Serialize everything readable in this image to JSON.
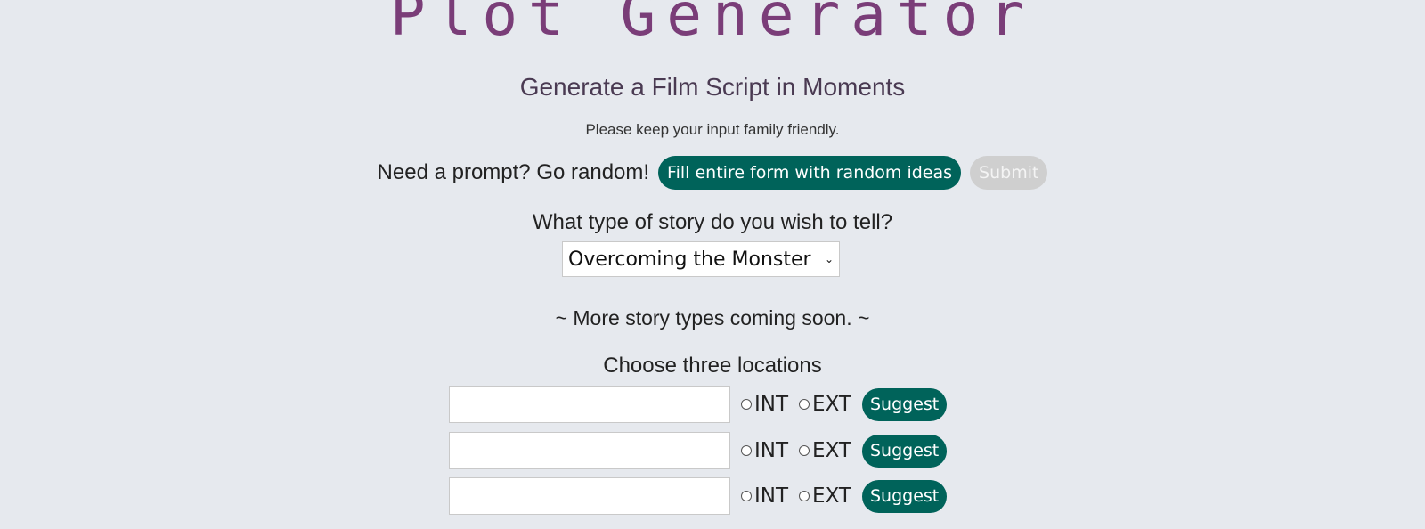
{
  "header": {
    "title": "Plot Generator",
    "subtitle": "Generate a Film Script in Moments",
    "note": "Please keep your input family friendly."
  },
  "random": {
    "prompt_text": "Need a prompt? Go random!",
    "fill_button": "Fill entire form with random ideas",
    "submit_button": "Submit"
  },
  "story_type": {
    "question": "What type of story do you wish to tell?",
    "selected": "Overcoming the Monster",
    "coming_soon": "~ More story types coming soon. ~"
  },
  "locations": {
    "heading": "Choose three locations",
    "rows": [
      {
        "value": "",
        "int_label": "INT",
        "ext_label": "EXT",
        "suggest_label": "Suggest"
      },
      {
        "value": "",
        "int_label": "INT",
        "ext_label": "EXT",
        "suggest_label": "Suggest"
      },
      {
        "value": "",
        "int_label": "INT",
        "ext_label": "EXT",
        "suggest_label": "Suggest"
      }
    ]
  },
  "colors": {
    "background": "#e6e9ee",
    "title": "#7a3d78",
    "accent_button": "#00635a",
    "disabled_button": "#cfcfcf"
  }
}
